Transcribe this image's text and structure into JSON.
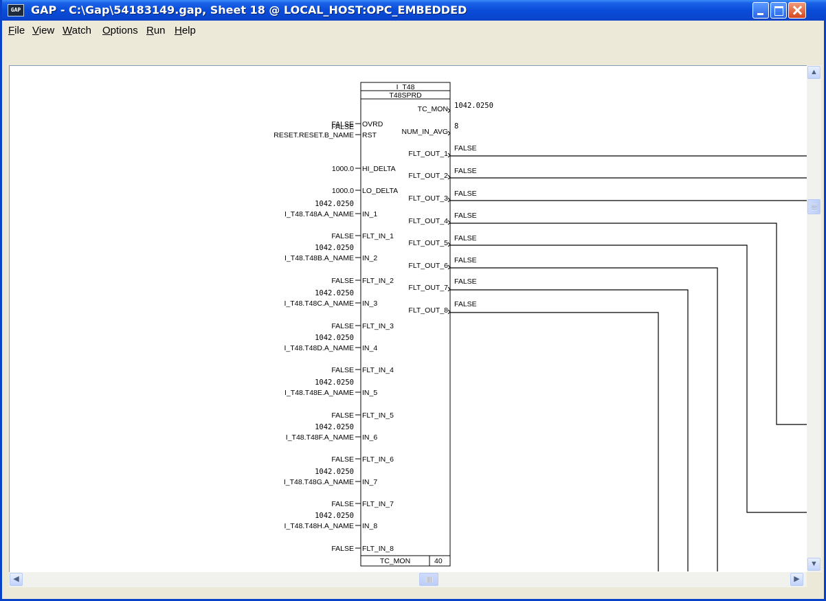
{
  "window": {
    "icon_text": "GAP",
    "title": "GAP - C:\\Gap\\54183149.gap, Sheet 18    @ LOCAL_HOST:OPC_EMBEDDED"
  },
  "menu": [
    {
      "label": "File",
      "u": "F",
      "rest": "ile"
    },
    {
      "label": "View",
      "u": "V",
      "rest": "iew"
    },
    {
      "label": "Watch",
      "u": "W",
      "rest": "atch"
    },
    {
      "label": "Options",
      "u": "O",
      "rest": "ptions"
    },
    {
      "label": "Run",
      "u": "R",
      "rest": "un"
    },
    {
      "label": "Help",
      "u": "H",
      "rest": "elp"
    }
  ],
  "block": {
    "name": "I_T48",
    "type": "T48SPRD",
    "footer_name": "TC_MON",
    "footer_num": "40",
    "colors": {
      "normal": "#000000",
      "alarm": "#FF0000"
    },
    "inputs": [
      {
        "pin": "OVRD",
        "value": "FALSE",
        "value_color": "normal",
        "signal": ""
      },
      {
        "pin": "RST",
        "value": "FALSE",
        "value_color": "alarm",
        "signal": "RESET.RESET.B_NAME"
      },
      {
        "pin": "HI_DELTA",
        "value": "",
        "value_color": "normal",
        "signal": "1000.0"
      },
      {
        "pin": "LO_DELTA",
        "value": "",
        "value_color": "normal",
        "signal": "1000.0"
      },
      {
        "pin": "IN_1",
        "value": "1042.0250",
        "value_color": "normal",
        "signal": "I_T48.T48A.A_NAME"
      },
      {
        "pin": "FLT_IN_1",
        "value": "",
        "value_color": "normal",
        "signal": "FALSE"
      },
      {
        "pin": "IN_2",
        "value": "1042.0250",
        "value_color": "normal",
        "signal": "I_T48.T48B.A_NAME"
      },
      {
        "pin": "FLT_IN_2",
        "value": "",
        "value_color": "normal",
        "signal": "FALSE"
      },
      {
        "pin": "IN_3",
        "value": "1042.0250",
        "value_color": "normal",
        "signal": "I_T48.T48C.A_NAME"
      },
      {
        "pin": "FLT_IN_3",
        "value": "",
        "value_color": "normal",
        "signal": "FALSE"
      },
      {
        "pin": "IN_4",
        "value": "1042.0250",
        "value_color": "normal",
        "signal": "I_T48.T48D.A_NAME"
      },
      {
        "pin": "FLT_IN_4",
        "value": "",
        "value_color": "normal",
        "signal": "FALSE"
      },
      {
        "pin": "IN_5",
        "value": "1042.0250",
        "value_color": "normal",
        "signal": "I_T48.T48E.A_NAME"
      },
      {
        "pin": "FLT_IN_5",
        "value": "",
        "value_color": "normal",
        "signal": "FALSE"
      },
      {
        "pin": "IN_6",
        "value": "1042.0250",
        "value_color": "normal",
        "signal": "I_T48.T48F.A_NAME"
      },
      {
        "pin": "FLT_IN_6",
        "value": "",
        "value_color": "normal",
        "signal": "FALSE"
      },
      {
        "pin": "IN_7",
        "value": "1042.0250",
        "value_color": "normal",
        "signal": "I_T48.T48G.A_NAME"
      },
      {
        "pin": "FLT_IN_7",
        "value": "",
        "value_color": "normal",
        "signal": "FALSE"
      },
      {
        "pin": "IN_8",
        "value": "1042.0250",
        "value_color": "normal",
        "signal": "I_T48.T48H.A_NAME"
      },
      {
        "pin": "FLT_IN_8",
        "value": "",
        "value_color": "normal",
        "signal": "FALSE"
      }
    ],
    "outputs": [
      {
        "pin": "TC_MON",
        "value": "1042.0250",
        "value_color": "normal"
      },
      {
        "pin": "NUM_IN_AVG",
        "value": "8",
        "value_color": "normal"
      },
      {
        "pin": "FLT_OUT_1",
        "value": "FALSE",
        "value_color": "alarm"
      },
      {
        "pin": "FLT_OUT_2",
        "value": "FALSE",
        "value_color": "alarm"
      },
      {
        "pin": "FLT_OUT_3",
        "value": "FALSE",
        "value_color": "alarm"
      },
      {
        "pin": "FLT_OUT_4",
        "value": "FALSE",
        "value_color": "alarm"
      },
      {
        "pin": "FLT_OUT_5",
        "value": "FALSE",
        "value_color": "alarm"
      },
      {
        "pin": "FLT_OUT_6",
        "value": "FALSE",
        "value_color": "alarm"
      },
      {
        "pin": "FLT_OUT_7",
        "value": "FALSE",
        "value_color": "alarm"
      },
      {
        "pin": "FLT_OUT_8",
        "value": "FALSE",
        "value_color": "alarm"
      }
    ]
  }
}
